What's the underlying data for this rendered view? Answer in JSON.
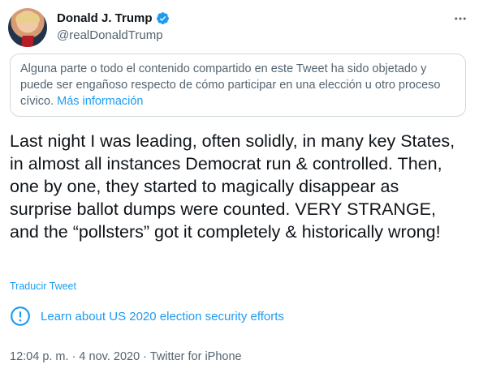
{
  "header": {
    "name": "Donald J. Trump",
    "handle": "@realDonaldTrump",
    "verified_icon": "verified-badge-icon",
    "more_icon": "more-options-icon"
  },
  "notice": {
    "text": "Alguna parte o todo el contenido compartido en este Tweet ha sido objetado y puede ser engañoso respecto de cómo participar en una elección u otro proceso cívico. ",
    "link": "Más información"
  },
  "tweet": {
    "text": "Last night I was leading, often solidly, in many key States, in almost all instances Democrat run & controlled. Then, one by one, they started to magically disappear as surprise ballot dumps were counted. VERY STRANGE, and the “pollsters” got it completely & historically wrong!",
    "translate": "Traducir Tweet"
  },
  "election": {
    "icon": "info-circle-icon",
    "label": "Learn about US 2020 election security efforts"
  },
  "meta": {
    "line": "12:04 p. m. · 4 nov. 2020 · Twitter for iPhone"
  },
  "colors": {
    "accent": "#1d9bf0",
    "text": "#0f1419",
    "muted": "#536471",
    "border": "#cfd9de"
  }
}
